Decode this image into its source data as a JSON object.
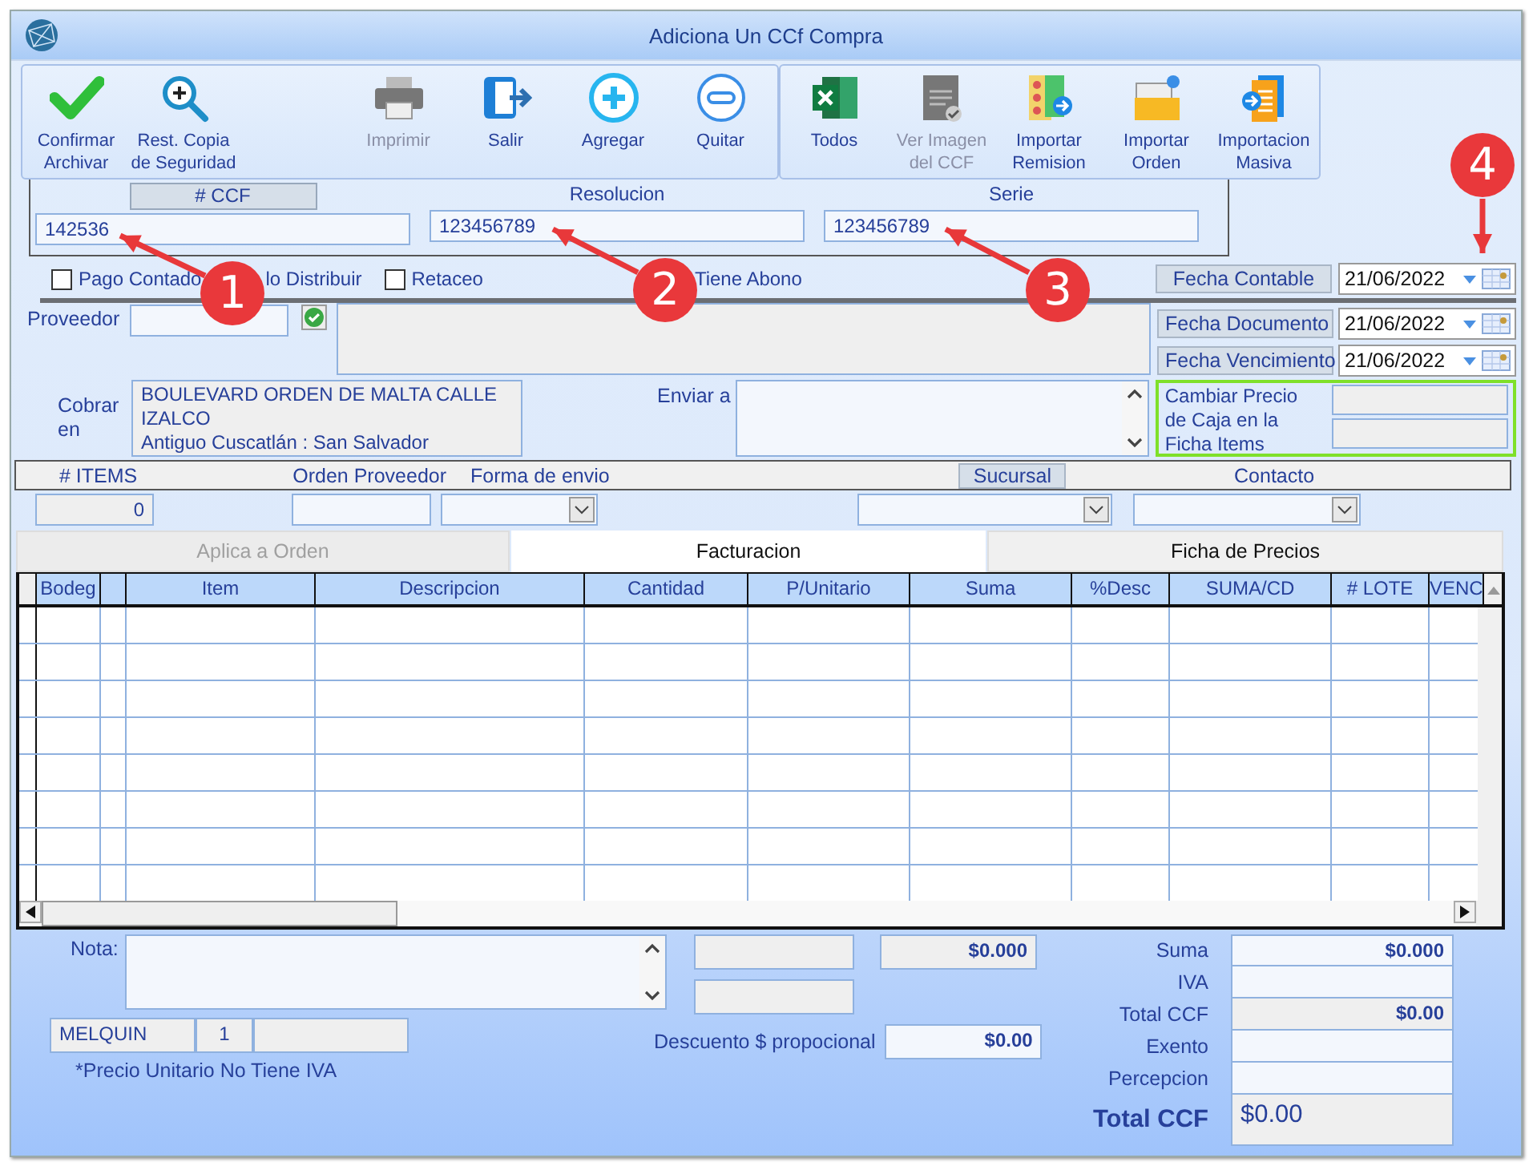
{
  "window": {
    "title": "Adiciona Un CCf Compra"
  },
  "toolbar": {
    "groups": [
      [
        {
          "kind": "confirm",
          "lines": [
            "Confirmar",
            "Archivar"
          ],
          "disabled": false
        },
        {
          "kind": "restore",
          "lines": [
            "Rest. Copia",
            "de Seguridad"
          ],
          "disabled": false
        },
        {
          "kind": "spacer"
        },
        {
          "kind": "print",
          "lines": [
            "Imprimir"
          ],
          "disabled": true
        },
        {
          "kind": "exit",
          "lines": [
            "Salir"
          ],
          "disabled": false
        },
        {
          "kind": "add",
          "lines": [
            "Agregar"
          ],
          "disabled": false
        },
        {
          "kind": "remove",
          "lines": [
            "Quitar"
          ],
          "disabled": false
        }
      ],
      [
        {
          "kind": "excel",
          "lines": [
            "Todos"
          ],
          "disabled": false
        },
        {
          "kind": "image",
          "lines": [
            "Ver Imagen",
            "del CCF"
          ],
          "disabled": true
        },
        {
          "kind": "remision",
          "lines": [
            "Importar",
            "Remision"
          ],
          "disabled": false
        },
        {
          "kind": "orden",
          "lines": [
            "Importar",
            "Orden"
          ],
          "disabled": false
        },
        {
          "kind": "masiva",
          "lines": [
            "Importacion",
            "Masiva"
          ],
          "disabled": false
        }
      ]
    ]
  },
  "document_ids": [
    {
      "label": "# CCF",
      "boxed": true,
      "value": "142536"
    },
    {
      "label": "Resolucion",
      "boxed": false,
      "value": "123456789"
    },
    {
      "label": "Serie",
      "boxed": false,
      "value": "123456789"
    }
  ],
  "options": [
    {
      "label": "Pago Contado",
      "checked": false
    },
    {
      "label": "lo Distribuir"
    },
    {
      "label": "Retaceo",
      "checked": false
    },
    {
      "label": "Tiene Abono"
    }
  ],
  "dates": [
    {
      "label": "Fecha Contable",
      "value": "21/06/2022"
    },
    {
      "label": "Fecha Documento",
      "value": "21/06/2022"
    },
    {
      "label": "Fecha Vencimiento",
      "value": "21/06/2022"
    }
  ],
  "proveedor": {
    "label": "Proveedor"
  },
  "cobrar_en": {
    "label": "Cobrar en",
    "lines": [
      "BOULEVARD ORDEN DE MALTA CALLE",
      "IZALCO",
      "Antiguo Cuscatlán : San Salvador"
    ]
  },
  "enviar_a": {
    "label": "Enviar a"
  },
  "cambiar_precio": {
    "label": "Cambiar Precio de Caja en la Ficha Items"
  },
  "info_strip": [
    {
      "kind": "number",
      "label": "# ITEMS",
      "boxed": false,
      "value": "0"
    },
    {
      "kind": "text",
      "label": "Orden Proveedor",
      "boxed": false
    },
    {
      "kind": "dropdown",
      "label": "Forma de envio",
      "boxed": false
    },
    {
      "kind": "dropdown",
      "label": "Sucursal",
      "boxed": true
    },
    {
      "kind": "dropdown",
      "label": "Contacto",
      "boxed": false
    }
  ],
  "tabs": [
    {
      "label": "Aplica a Orden",
      "selected": false,
      "disabled": true
    },
    {
      "label": "Facturacion",
      "selected": true,
      "disabled": false
    },
    {
      "label": "Ficha de Precios",
      "selected": false,
      "disabled": false
    }
  ],
  "table": {
    "columns": [
      "Bodeg",
      "Item",
      "Descripcion",
      "Cantidad",
      "P/Unitario",
      "Suma",
      "%Desc",
      "SUMA/CD",
      "# LOTE",
      "VENC"
    ]
  },
  "nota": {
    "label": "Nota:"
  },
  "user_fields": [
    "MELQUIN",
    "1"
  ],
  "footnote": "*Precio Unitario No Tiene IVA",
  "middle": {
    "amount": "$0.000",
    "descuento_label": "Descuento $ propocional",
    "descuento_value": "$0.00"
  },
  "totals": [
    {
      "label": "Suma",
      "value": "$0.000",
      "shaded": false
    },
    {
      "label": "IVA",
      "shaded": false
    },
    {
      "label": "Total CCF",
      "value": "$0.00",
      "shaded": true
    },
    {
      "label": "Exento",
      "shaded": false
    },
    {
      "label": "Percepcion",
      "shaded": false
    }
  ],
  "grand_total": {
    "label": "Total CCF",
    "value": "$0.00"
  },
  "callouts": [
    "1",
    "2",
    "3",
    "4"
  ]
}
